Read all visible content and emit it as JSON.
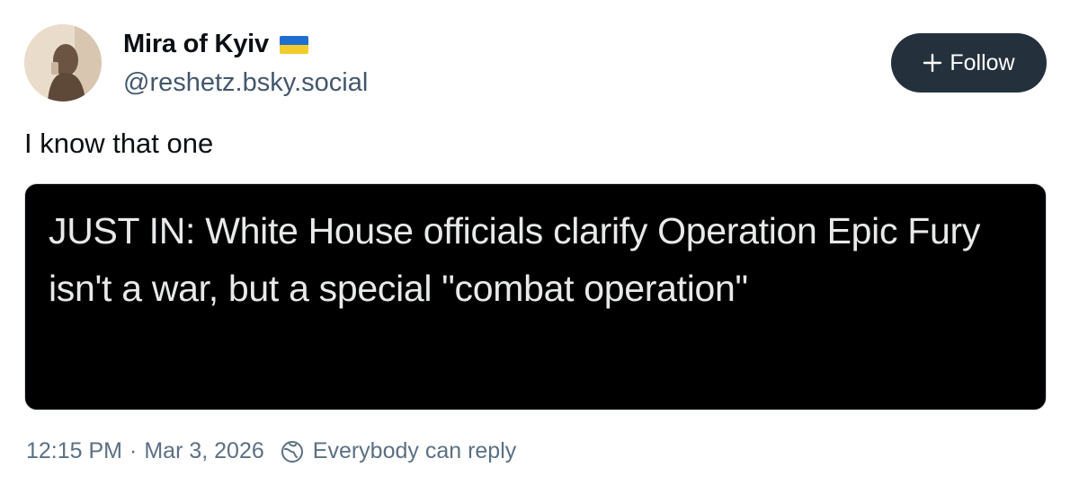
{
  "author": {
    "display_name": "Mira of Kyiv",
    "handle": "@reshetz.bsky.social",
    "flag_icon": "ukraine-flag-icon",
    "flag_colors": [
      "#1f6fd1",
      "#f2cc2c"
    ]
  },
  "follow_button": {
    "label": "Follow",
    "icon": "plus-icon",
    "background": "#25303d"
  },
  "post": {
    "text": "I know that one",
    "embed_text": "JUST IN: White House officials clarify Operation Epic Fury isn't a war, but a special \"combat operation\""
  },
  "meta": {
    "time": "12:15 PM",
    "separator": "·",
    "date": "Mar 3, 2026",
    "reply_setting": "Everybody can reply",
    "reply_icon": "globe-icon"
  }
}
